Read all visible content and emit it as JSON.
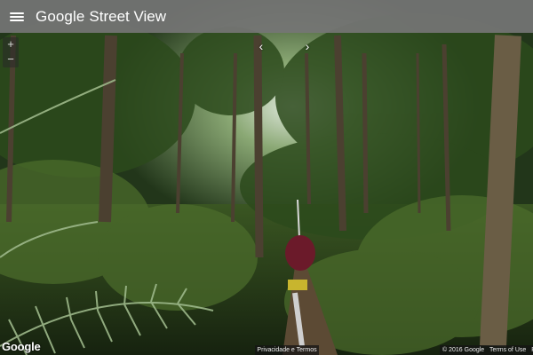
{
  "header": {
    "menu_icon": "hamburger-menu-icon",
    "brand_google": "Google",
    "brand_product": "Street View"
  },
  "controls": {
    "zoom_in": "+",
    "zoom_out": "−",
    "prev_arrow": "‹",
    "next_arrow": "›"
  },
  "footer": {
    "logo": "Google",
    "privacy": "Privacidade e Termos",
    "copyright": "© 2016 Google",
    "terms": "Terms of Use",
    "report": "Re"
  },
  "colors": {
    "topbar": "#757575",
    "foliage_dark": "#0e1a0c",
    "foliage_mid": "#3f5a25",
    "sky": "#c9d8c8"
  }
}
